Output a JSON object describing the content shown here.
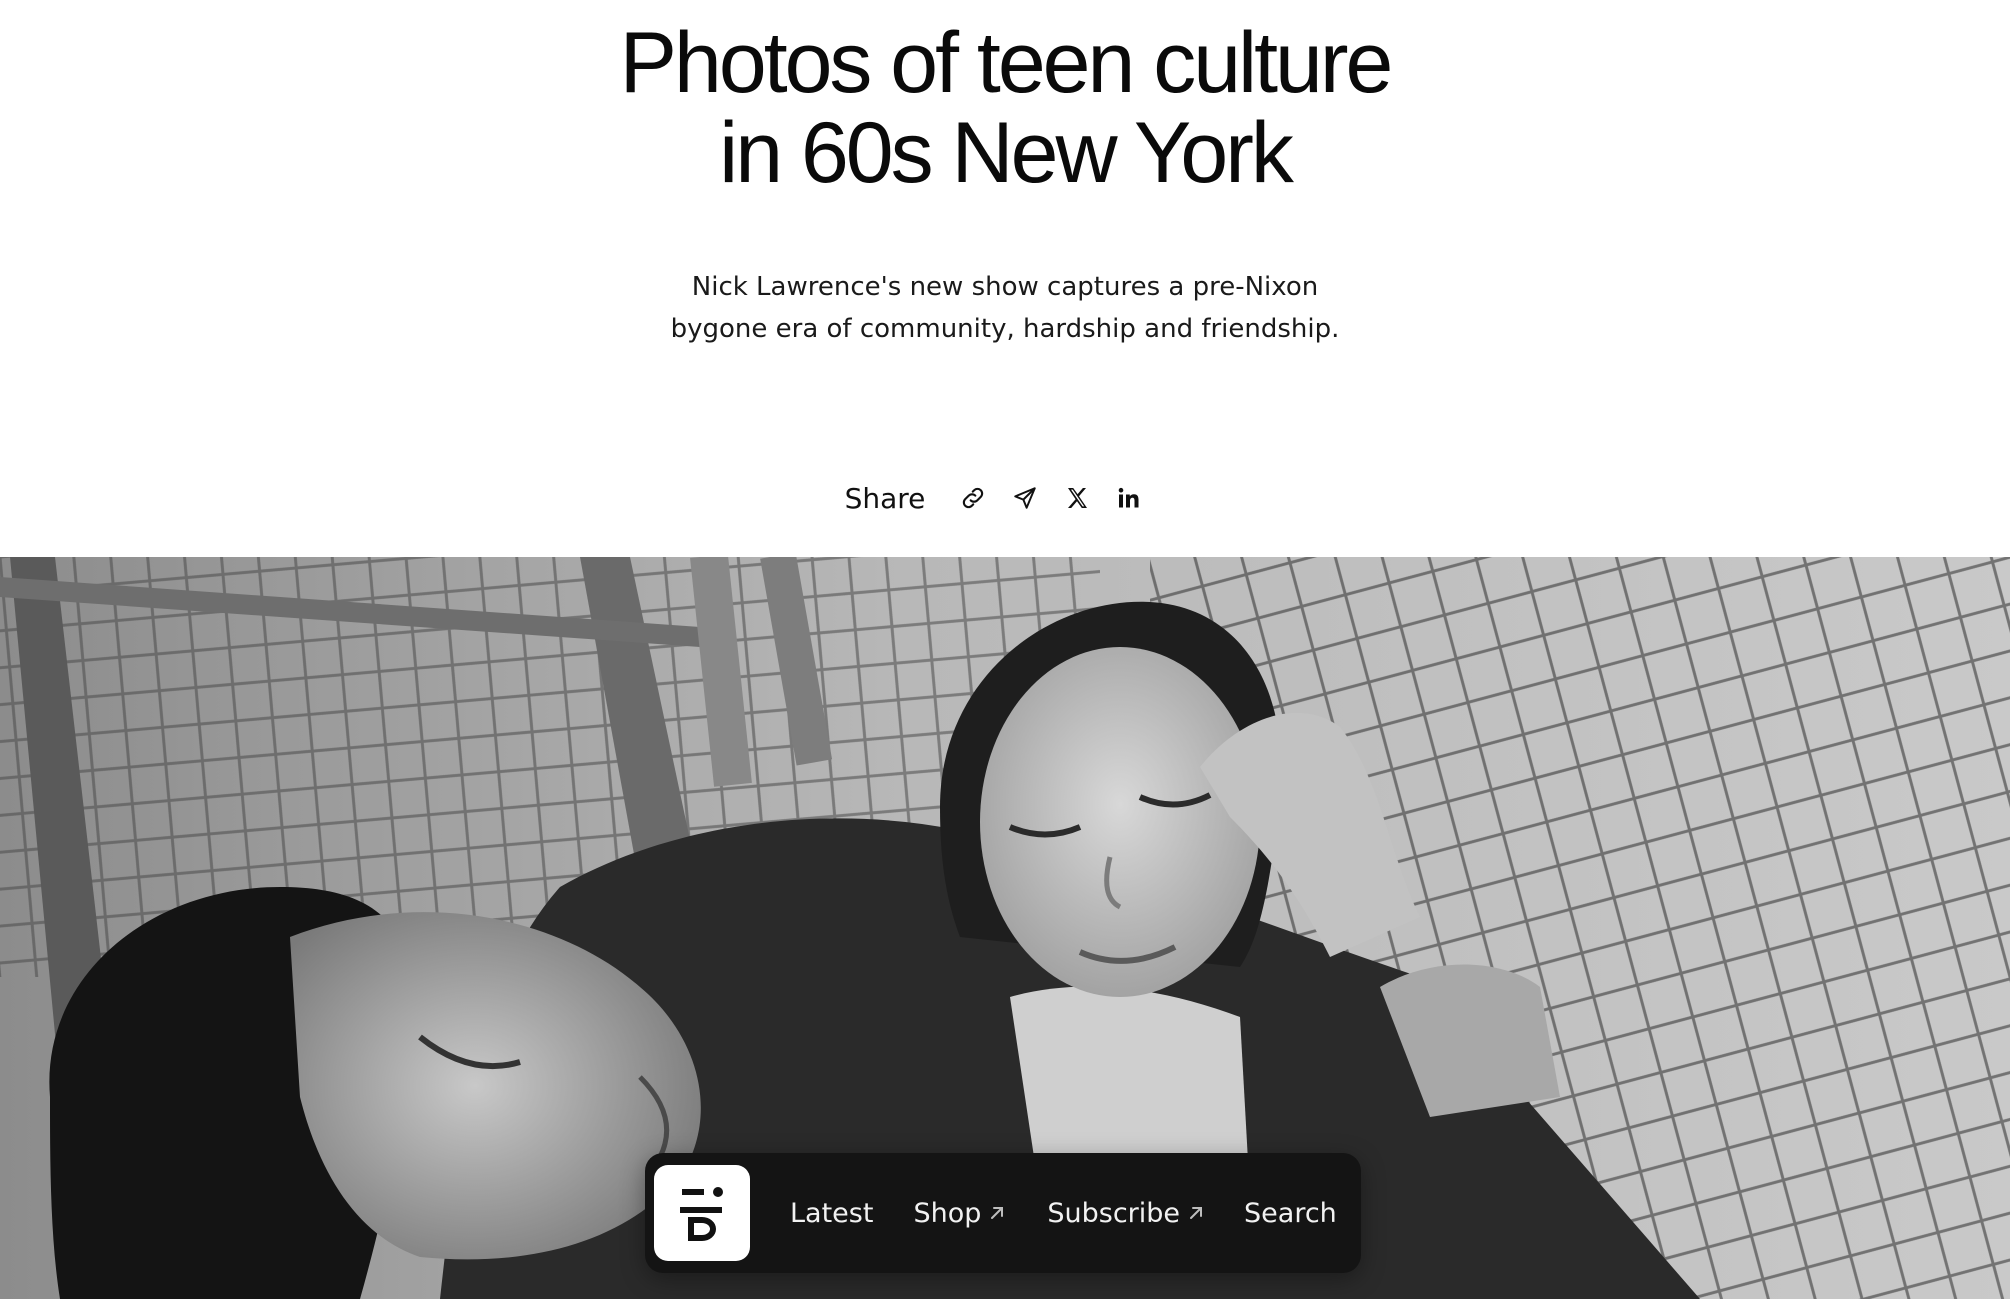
{
  "article": {
    "headline_line1": "Photos of teen culture",
    "headline_line2": "in 60s New York",
    "standfirst_line1": "Nick Lawrence's new show captures a pre-Nixon",
    "standfirst_line2": "bygone era of community, hardship and friendship."
  },
  "share": {
    "label": "Share",
    "buttons": [
      {
        "icon": "link-icon"
      },
      {
        "icon": "send-icon"
      },
      {
        "icon": "x-icon"
      },
      {
        "icon": "linkedin-icon"
      }
    ]
  },
  "hero_image": {
    "description_icon": "photo"
  },
  "nav": {
    "logo": "i-D",
    "items": [
      {
        "label": "Latest",
        "external": false
      },
      {
        "label": "Shop",
        "external": true
      },
      {
        "label": "Subscribe",
        "external": true
      },
      {
        "label": "Search",
        "external": false
      }
    ]
  },
  "colors": {
    "text": "#111111",
    "nav_background": "#141414",
    "nav_text": "#f2f2f2",
    "logo_tile": "#ffffff"
  }
}
